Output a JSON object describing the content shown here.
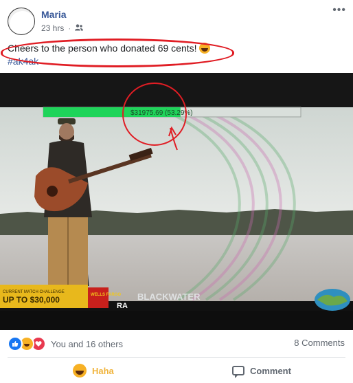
{
  "header": {
    "author": "Maria",
    "time": "23 hrs",
    "more_label": "•••"
  },
  "post": {
    "text": "Cheers to the person who donated 69 cents!",
    "hashtag": "#ak4ak"
  },
  "photo": {
    "donation_readout": "$31975.69 (53.29%)",
    "progress_percent": 53.29,
    "banner_line1": "CURRENT MATCH CHALLENGE",
    "banner_line2": "UP TO $30,000",
    "sponsor": "WELLS FARGO",
    "watermark": "BLACKWATER",
    "watermark_sub": "RA"
  },
  "reactions": {
    "summary": "You and 16 others",
    "comments": "8 Comments"
  },
  "actions": {
    "haha_label": "Haha",
    "comment_label": "Comment"
  },
  "colors": {
    "author": "#385898",
    "highlight": "#e01d24",
    "progress_fill": "#1fd45a",
    "haha": "#f0b43c"
  }
}
